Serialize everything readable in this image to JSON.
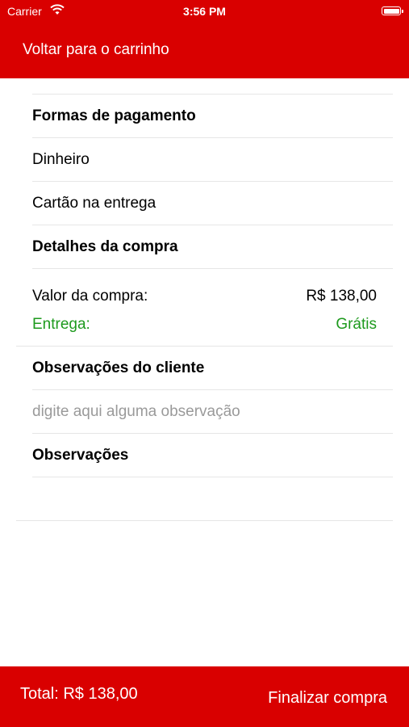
{
  "status_bar": {
    "carrier": "Carrier",
    "time": "3:56 PM"
  },
  "header": {
    "back_label": "Voltar para o carrinho",
    "bg_color": "#d90000"
  },
  "sections": {
    "payment": {
      "title": "Formas de pagamento",
      "options": [
        "Dinheiro",
        "Cartão na entrega"
      ]
    },
    "purchase": {
      "title": "Detalhes da compra",
      "value_label": "Valor da compra:",
      "value": "R$ 138,00",
      "delivery_label": "Entrega:",
      "delivery_value": "Grátis"
    },
    "client_notes": {
      "title": "Observações do cliente",
      "placeholder": "digite aqui alguma observação"
    },
    "notes": {
      "title": "Observações"
    }
  },
  "footer": {
    "total": "Total: R$ 138,00",
    "finish_label": "Finalizar compra"
  },
  "colors": {
    "accent": "#d90000",
    "green": "#1e9a1e"
  }
}
